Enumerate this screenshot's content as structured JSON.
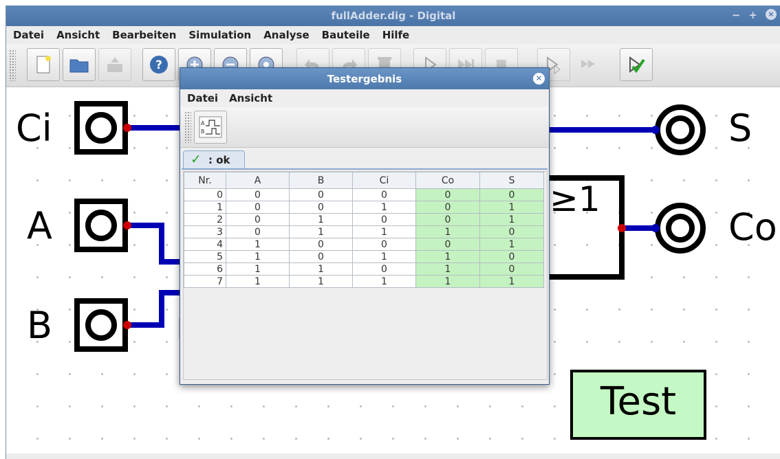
{
  "window": {
    "title": "fullAdder.dig - Digital",
    "controls": [
      "−",
      "+",
      "×"
    ]
  },
  "menubar": {
    "items": [
      "Datei",
      "Ansicht",
      "Bearbeiten",
      "Simulation",
      "Analyse",
      "Bauteile",
      "Hilfe"
    ]
  },
  "toolbar": {
    "icons": [
      "new-file-icon",
      "open-folder-icon",
      "save-icon",
      "help-icon",
      "zoom-in-icon",
      "zoom-out-icon",
      "zoom-fit-icon",
      "undo-icon",
      "redo-icon",
      "delete-icon",
      "run-icon",
      "step-icon",
      "stop-icon",
      "micro-step-icon",
      "fast-forward-icon",
      "test-check-icon"
    ]
  },
  "circuit": {
    "inputs": [
      "Ci",
      "A",
      "B"
    ],
    "outputs": [
      "S",
      "Co"
    ],
    "or_gate_label": "≥1",
    "test_label": "Test",
    "colors": {
      "wire": "#0000b4",
      "pin": "#cc0000",
      "test_fill": "#c4f8c4"
    }
  },
  "dialog": {
    "title": "Testergebnis",
    "menu": [
      "Datei",
      "Ansicht"
    ],
    "tab": {
      "check": "✓",
      "label": ": ok"
    },
    "table": {
      "headers": [
        "Nr.",
        "A",
        "B",
        "Ci",
        "Co",
        "S"
      ],
      "rows": [
        [
          "0",
          "0",
          "0",
          "0",
          "0",
          "0"
        ],
        [
          "1",
          "0",
          "0",
          "1",
          "0",
          "1"
        ],
        [
          "2",
          "0",
          "1",
          "0",
          "0",
          "1"
        ],
        [
          "3",
          "0",
          "1",
          "1",
          "1",
          "0"
        ],
        [
          "4",
          "1",
          "0",
          "0",
          "0",
          "1"
        ],
        [
          "5",
          "1",
          "0",
          "1",
          "1",
          "0"
        ],
        [
          "6",
          "1",
          "1",
          "0",
          "1",
          "0"
        ],
        [
          "7",
          "1",
          "1",
          "1",
          "1",
          "1"
        ]
      ],
      "pass_color": "#c4f2c0"
    }
  }
}
